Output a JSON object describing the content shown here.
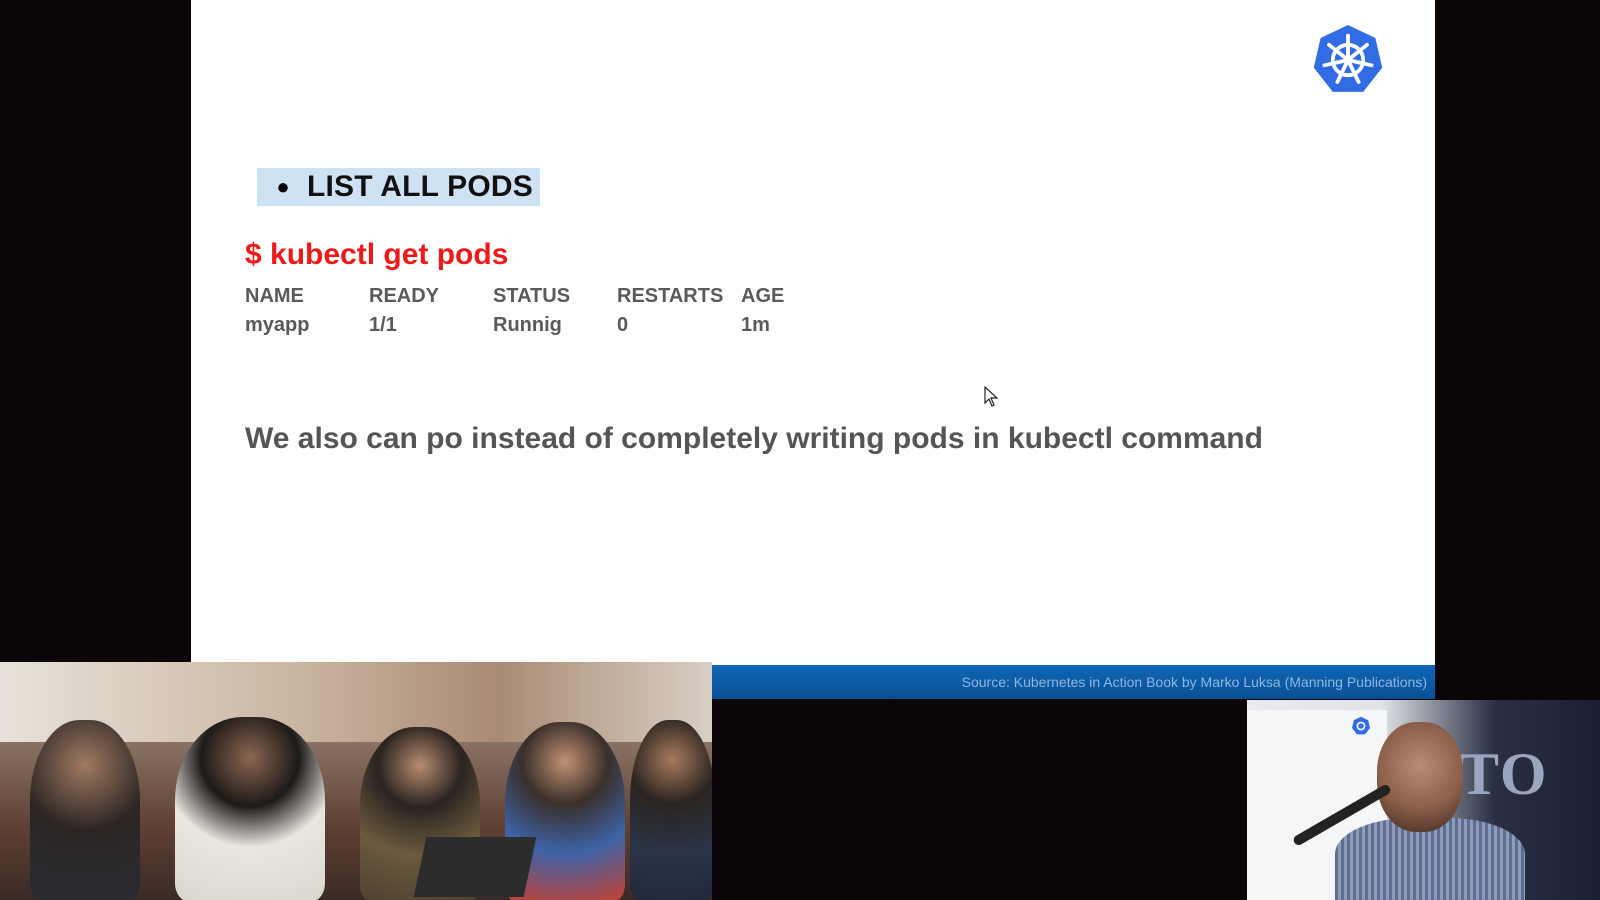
{
  "slide": {
    "heading_bullet": "●",
    "heading": "LIST ALL PODS",
    "command": "$ kubectl get pods",
    "table": {
      "headers": [
        "NAME",
        "READY",
        "STATUS",
        "RESTARTS",
        "AGE"
      ],
      "rows": [
        [
          "myapp",
          "1/1",
          "Runnig",
          "0",
          "1m"
        ]
      ]
    },
    "note": "We also can po instead of completely writing pods in kubectl command",
    "source": "Source: Kubernetes in Action Book by Marko Luksa (Manning Publications)",
    "logo_icon": "kubernetes-helm-icon"
  },
  "presenter_feed": {
    "banner_text": "TO"
  },
  "colors": {
    "command_red": "#ee1a1a",
    "highlight_blue": "#cfe2f3",
    "footer_blue": "#0d5ba8",
    "k8s_blue": "#326ce5"
  }
}
